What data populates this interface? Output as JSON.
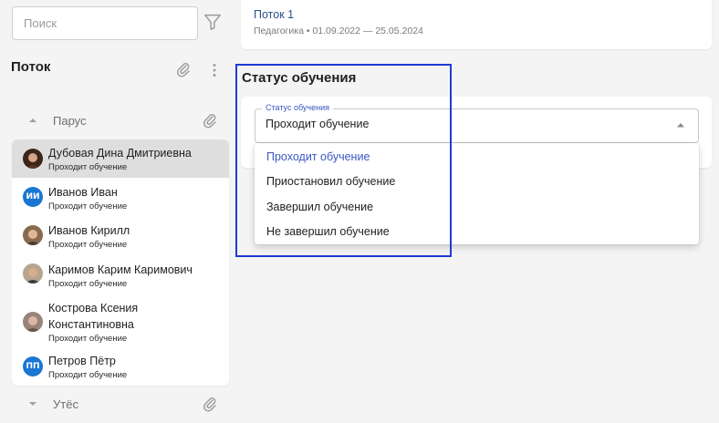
{
  "search": {
    "placeholder": "Поиск"
  },
  "sidebar": {
    "title": "Поток",
    "groups": [
      {
        "name": "Парус",
        "expanded": true
      },
      {
        "name": "Утёс",
        "expanded": false
      }
    ],
    "students": [
      {
        "name": "Дубовая Дина Дмитриевна",
        "status": "Проходит обучение",
        "avatar": "photo",
        "selected": true
      },
      {
        "name": "Иванов Иван",
        "status": "Проходит обучение",
        "avatar": "initials",
        "initials": "ИИ"
      },
      {
        "name": "Иванов Кирилл",
        "status": "Проходит обучение",
        "avatar": "photo"
      },
      {
        "name": "Каримов Карим Каримович",
        "status": "Проходит обучение",
        "avatar": "photo"
      },
      {
        "name": "Кострова Ксения Константиновна",
        "status": "Проходит обучение",
        "avatar": "photo"
      },
      {
        "name": "Петров Пётр",
        "status": "Проходит обучение",
        "avatar": "initials",
        "initials": "ПП"
      }
    ]
  },
  "stream": {
    "name": "Поток 1",
    "subject": "Педагогика",
    "dates": "01.09.2022 — 25.05.2024"
  },
  "status_section": {
    "title": "Статус обучения",
    "field_label": "Статус обучения",
    "value": "Проходит обучение",
    "options": [
      "Проходит обучение",
      "Приостановил обучение",
      "Завершил обучение",
      "Не завершил обучение"
    ]
  },
  "colors": {
    "accent": "#3b57c4",
    "link": "#2c4e8a",
    "avatar_initials_bg": "#1976d2",
    "highlight": "#1f3bd3",
    "selected_row": "#dedede"
  }
}
